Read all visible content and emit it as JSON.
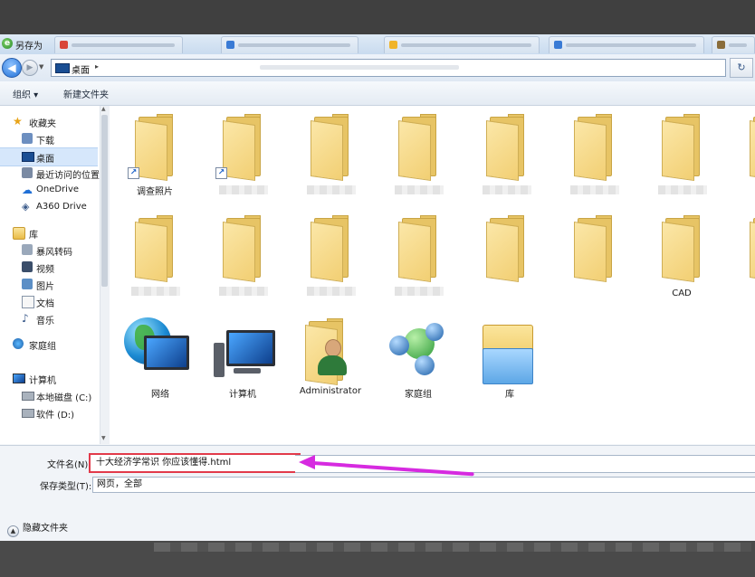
{
  "window": {
    "title": "另存为",
    "background_tabs": [
      {
        "favicon_color": "#d9463a"
      },
      {
        "favicon_color": "#3a7bd5"
      },
      {
        "favicon_color": "#f0b429"
      },
      {
        "favicon_color": "#3a7bd5"
      },
      {
        "favicon_color": "#8a6d3b"
      }
    ]
  },
  "navigation": {
    "back_icon": "back-arrow-icon",
    "forward_icon": "forward-arrow-icon",
    "address_path": "桌面",
    "address_separator": "▸",
    "refresh_icon": "refresh-icon"
  },
  "toolbar": {
    "organize_label": "组织 ▾",
    "new_folder_label": "新建文件夹"
  },
  "sidebar": {
    "favorites_label": "收藏夹",
    "downloads_label": "下载",
    "desktop_label": "桌面",
    "recent_label": "最近访问的位置",
    "onedrive_label": "OneDrive",
    "a360_label": "A360 Drive",
    "libraries_label": "库",
    "baofeng_label": "暴风转码",
    "videos_label": "视频",
    "pictures_label": "图片",
    "documents_label": "文档",
    "music_label": "音乐",
    "homegroup_label": "家庭组",
    "computer_label": "计算机",
    "local_disk_label": "本地磁盘 (C:)",
    "software_label": "软件 (D:)"
  },
  "files": {
    "folder_1_label": "调查照片",
    "folder_14_label": "CAD",
    "network_label": "网络",
    "computer_label": "计算机",
    "administrator_label": "Administrator",
    "homegroup_label": "家庭组",
    "library_label": "库"
  },
  "form": {
    "filename_label": "文件名(N):",
    "filename_value": "十大经济学常识 你应该懂得.html",
    "savetype_label": "保存类型(T):",
    "savetype_value": "网页，全部",
    "hide_folders_label": "隐藏文件夹"
  },
  "colors": {
    "annotation_box": "#e23a4a",
    "annotation_arrow": "#d62ae0",
    "selection": "#d6e7fb"
  }
}
